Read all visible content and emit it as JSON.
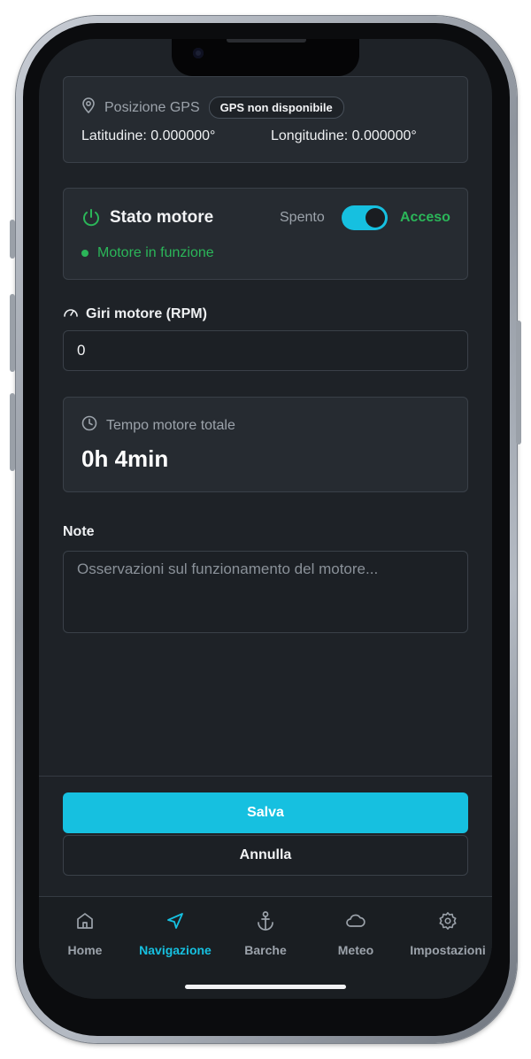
{
  "gps": {
    "title": "Posizione GPS",
    "badge": "GPS non disponibile",
    "latitude": "Latitudine: 0.000000°",
    "longitude": "Longitudine: 0.000000°"
  },
  "motor": {
    "title": "Stato motore",
    "off_label": "Spento",
    "on_label": "Acceso",
    "status": "Motore in funzione",
    "toggle_on": true
  },
  "rpm": {
    "label": "Giri motore (RPM)",
    "value": "0"
  },
  "engine_time": {
    "title": "Tempo motore totale",
    "value": "0h 4min"
  },
  "note": {
    "label": "Note",
    "placeholder": "Osservazioni sul funzionamento del motore..."
  },
  "actions": {
    "save": "Salva",
    "cancel": "Annulla"
  },
  "tabs": [
    {
      "label": "Home",
      "icon": "home-icon"
    },
    {
      "label": "Navigazione",
      "icon": "navigation-icon",
      "active": true
    },
    {
      "label": "Barche",
      "icon": "anchor-icon"
    },
    {
      "label": "Meteo",
      "icon": "cloud-icon"
    },
    {
      "label": "Impostazioni",
      "icon": "gear-icon"
    }
  ],
  "colors": {
    "accent": "#16c0e0",
    "success": "#2bb659",
    "background": "#1e2227",
    "card": "#262b31"
  }
}
